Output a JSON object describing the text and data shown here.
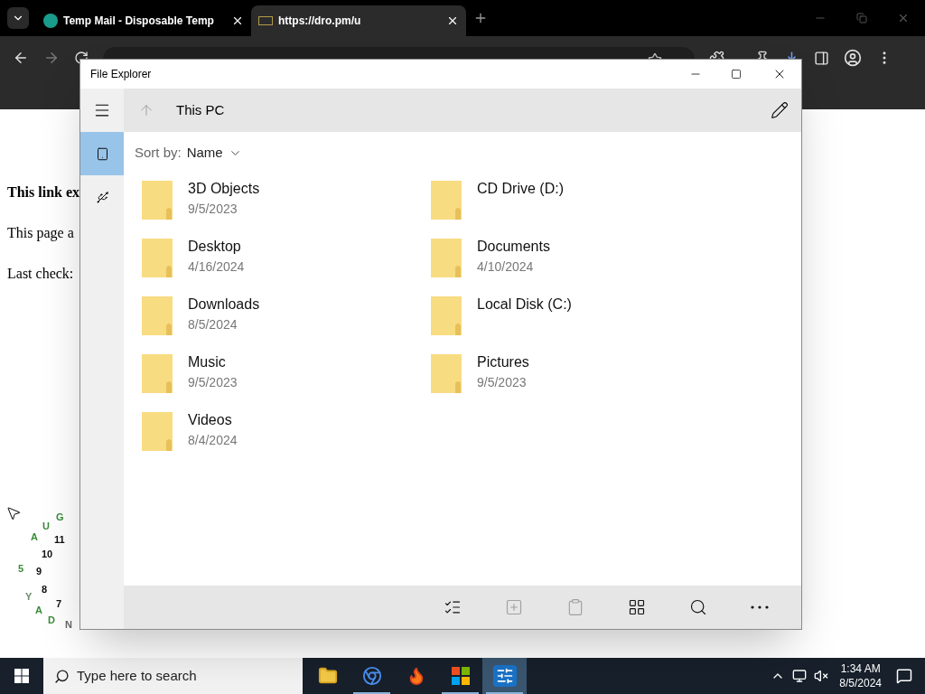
{
  "browser": {
    "tabs": [
      {
        "title": "Temp Mail - Disposable Temp",
        "selected": false
      },
      {
        "title": "https://dro.pm/u",
        "selected": true
      }
    ]
  },
  "page": {
    "lines": [
      {
        "text": "This link ex",
        "bold": true
      },
      {
        "text": "This page a",
        "bold": false
      },
      {
        "text": "Last check:",
        "bold": false
      }
    ],
    "clock_marks": [
      {
        "text": "G",
        "color": "#3a8a3a"
      },
      {
        "text": "U",
        "color": "#3a8a3a"
      },
      {
        "text": "A",
        "color": "#3a8a3a"
      },
      {
        "text": "11",
        "color": "#111111"
      },
      {
        "text": "10",
        "color": "#111111"
      },
      {
        "text": "5",
        "color": "#3a8a3a"
      },
      {
        "text": "9",
        "color": "#111111"
      },
      {
        "text": "8",
        "color": "#111111"
      },
      {
        "text": "Y",
        "color": "#6a8a6a"
      },
      {
        "text": "7",
        "color": "#111111"
      },
      {
        "text": "A",
        "color": "#3a8a3a"
      },
      {
        "text": "D",
        "color": "#3a8a3a"
      },
      {
        "text": "N",
        "color": "#666666"
      }
    ]
  },
  "explorer": {
    "title": "File Explorer",
    "location": "This PC",
    "nav_items": [
      {
        "kind": "device",
        "selected": true
      },
      {
        "kind": "usb",
        "selected": false
      }
    ],
    "sort": {
      "label": "Sort by:",
      "value": "Name"
    },
    "items": [
      {
        "name": "3D Objects",
        "date": "9/5/2023"
      },
      {
        "name": "CD Drive (D:)"
      },
      {
        "name": "Desktop",
        "date": "4/16/2024"
      },
      {
        "name": "Documents",
        "date": "4/10/2024"
      },
      {
        "name": "Downloads",
        "date": "8/5/2024"
      },
      {
        "name": "Local Disk (C:)"
      },
      {
        "name": "Music",
        "date": "9/5/2023"
      },
      {
        "name": "Pictures",
        "date": "9/5/2023"
      },
      {
        "name": "Videos",
        "date": "8/4/2024"
      }
    ],
    "commands": [
      {
        "kind": "select",
        "disabled": false
      },
      {
        "kind": "new",
        "disabled": true
      },
      {
        "kind": "paste",
        "disabled": true
      },
      {
        "kind": "view",
        "disabled": false
      },
      {
        "kind": "search",
        "disabled": false
      },
      {
        "kind": "more",
        "disabled": false
      }
    ]
  },
  "taskbar": {
    "search_placeholder": "Type here to search",
    "apps": [
      {
        "kind": "files",
        "running": false,
        "selected": false
      },
      {
        "kind": "chrome",
        "running": true,
        "selected": false
      },
      {
        "kind": "firefox",
        "running": false,
        "selected": false
      },
      {
        "kind": "store",
        "running": true,
        "selected": false
      },
      {
        "kind": "explorer",
        "running": true,
        "selected": true
      }
    ],
    "time": "1:34 AM",
    "date": "8/5/2024"
  }
}
